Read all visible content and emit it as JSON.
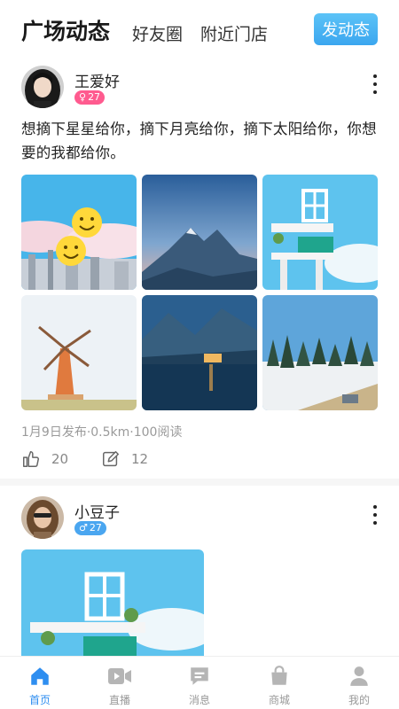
{
  "header": {
    "title": "广场动态",
    "tabs": [
      "好友圈",
      "附近门店"
    ],
    "post_button": "发动态"
  },
  "posts": [
    {
      "user": "王爱好",
      "gender": "female",
      "gender_symbol": "♀",
      "age": "27",
      "text": "想摘下星星给你，摘下月亮给你，摘下太阳给你，你想要的我都给你。",
      "images": [
        "balloons-city-photo",
        "mountain-dusk-photo",
        "white-staircase-photo",
        "windmill-photo",
        "lake-town-night-photo",
        "snowy-forest-photo"
      ],
      "meta": "1月9日发布·0.5km·100阅读",
      "likes": "20",
      "comments": "12"
    },
    {
      "user": "小豆子",
      "gender": "male",
      "gender_symbol": "♂",
      "age": "27",
      "images": [
        "white-staircase-photo"
      ]
    }
  ],
  "nav": [
    {
      "label": "首页",
      "icon": "home-icon",
      "active": true
    },
    {
      "label": "直播",
      "icon": "video-icon",
      "active": false
    },
    {
      "label": "消息",
      "icon": "message-icon",
      "active": false
    },
    {
      "label": "商城",
      "icon": "shopping-bag-icon",
      "active": false
    },
    {
      "label": "我的",
      "icon": "profile-icon",
      "active": false
    }
  ],
  "colors": {
    "accent": "#2e8ef0",
    "post_button": "#4ab0f3",
    "female_badge": "#ff5b8f",
    "male_badge": "#4aa6f0"
  }
}
